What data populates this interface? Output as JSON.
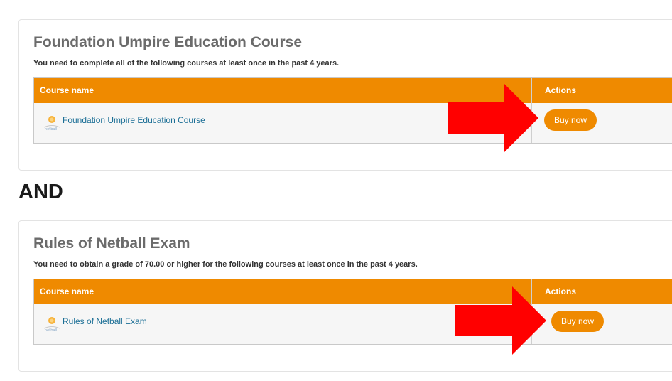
{
  "requirements": [
    {
      "title": "Foundation Umpire Education Course",
      "description": "You need to complete all of the following courses at least once in the past 4 years.",
      "table": {
        "col_course_name": "Course name",
        "col_actions": "Actions"
      },
      "course": {
        "logo": "netball-logo-icon",
        "name": "Foundation Umpire Education Course",
        "action_label": "Buy now"
      }
    },
    {
      "title": "Rules of Netball Exam",
      "description": "You need to obtain a grade of 70.00 or higher for the following courses at least once in the past 4 years.",
      "table": {
        "col_course_name": "Course name",
        "col_actions": "Actions"
      },
      "course": {
        "logo": "netball-logo-icon",
        "name": "Rules of Netball Exam",
        "action_label": "Buy now"
      }
    }
  ],
  "connector": "AND",
  "annotations": {
    "arrow": "red-arrow-icon",
    "arrow_color": "#ff0000"
  },
  "colors": {
    "accent": "#ef8a00",
    "link": "#1c6f96",
    "panel_title": "#6b6b6b"
  }
}
